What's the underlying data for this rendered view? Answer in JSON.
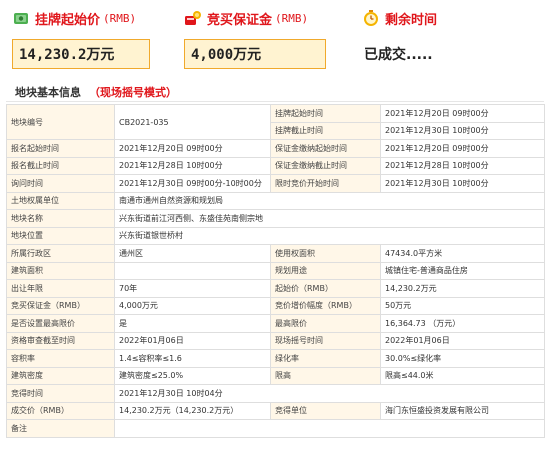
{
  "cards": [
    {
      "label": "挂牌起始价",
      "unit": "(RMB)",
      "value": "14,230.2万元",
      "icon": "money-bag-icon"
    },
    {
      "label": "竞买保证金",
      "unit": "(RMB)",
      "value": "4,000万元",
      "icon": "deposit-icon"
    },
    {
      "label": "剩余时间",
      "unit": "",
      "value": "已成交.....",
      "icon": "clock-icon"
    }
  ],
  "section": {
    "title": "地块基本信息",
    "mode": "（现场摇号模式）"
  },
  "table": {
    "r1": {
      "k1": "地块编号",
      "v1": "CB2021-035",
      "k2a": "挂牌起始时间",
      "v2a": "2021年12月20日 09时00分",
      "k2b": "挂牌截止时间",
      "v2b": "2021年12月30日 10时00分"
    },
    "r2": {
      "k1": "报名起始时间",
      "v1": "2021年12月20日 09时00分",
      "k2": "保证金缴纳起始时间",
      "v2": "2021年12月20日 09时00分"
    },
    "r3": {
      "k1": "报名截止时间",
      "v1": "2021年12月28日 10时00分",
      "k2": "保证金缴纳截止时间",
      "v2": "2021年12月28日 10时00分"
    },
    "r4": {
      "k1": "询问时间",
      "v1": "2021年12月30日 09时00分-10时00分",
      "k2": "限时竞价开始时间",
      "v2": "2021年12月30日 10时00分"
    },
    "r5": {
      "k1": "土地权属单位",
      "v1": "南通市通州自然资源和规划局"
    },
    "r6": {
      "k1": "地块名称",
      "v1": "兴东街道前江河西侧、东盛佳苑南侧宗地"
    },
    "r7": {
      "k1": "地块位置",
      "v1": "兴东街道银世桥村"
    },
    "r8": {
      "k1": "所属行政区",
      "v1": "通州区",
      "k2": "使用权面积",
      "v2": "47434.0平方米"
    },
    "r9": {
      "k1": "建筑面积",
      "v1": "",
      "k2": "规划用途",
      "v2": "城镇住宅-普通商品住房"
    },
    "r10": {
      "k1": "出让年限",
      "v1": "70年",
      "k2": "起始价（RMB）",
      "v2": "14,230.2万元"
    },
    "r11": {
      "k1": "竞买保证金（RMB）",
      "v1": "4,000万元",
      "k2": "竞价增价幅度（RMB）",
      "v2": "50万元"
    },
    "r12": {
      "k1": "是否设置最高限价",
      "v1": "是",
      "k2": "最高限价",
      "v2": "16,364.73 （万元）"
    },
    "r13": {
      "k1": "资格审查截至时间",
      "v1": "2022年01月06日",
      "k2": "现场摇号时间",
      "v2": "2022年01月06日"
    },
    "r14": {
      "k1": "容积率",
      "v1": "1.4≤容积率≤1.6",
      "k2": "绿化率",
      "v2": "30.0%≤绿化率"
    },
    "r15": {
      "k1": "建筑密度",
      "v1": "建筑密度≤25.0%",
      "k2": "限高",
      "v2": "限高≤44.0米"
    },
    "r16": {
      "k1": "竞得时间",
      "v1": "2021年12月30日 10时04分"
    },
    "r17": {
      "k1": "成交价（RMB）",
      "v1": "14,230.2万元（14,230.2万元）",
      "k2": "竞得单位",
      "v2": "海门东恒盛投资发展有限公司"
    },
    "r18": {
      "k1": "备注",
      "v1": ""
    }
  }
}
